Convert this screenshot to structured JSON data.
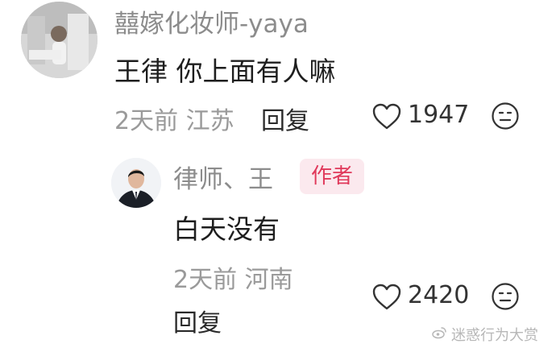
{
  "comment": {
    "author": "囍嫁化妆师-yaya",
    "text": "王律 你上面有人嘛",
    "meta": "2天前 江苏",
    "reply_label": "回复",
    "like_count": "1947"
  },
  "reply": {
    "author": "律师、王",
    "author_badge": "作者",
    "text": "白天没有",
    "meta": "2天前 河南",
    "reply_label": "回复",
    "like_count": "2420"
  },
  "watermark": "迷惑行为大赏",
  "icons": {
    "like": "heart-outline-icon",
    "dislike": "dislike-face-icon",
    "watermark": "weibo-logo-icon"
  },
  "colors": {
    "author_badge_bg": "#fbe9ee",
    "author_badge_text": "#e0395b"
  }
}
